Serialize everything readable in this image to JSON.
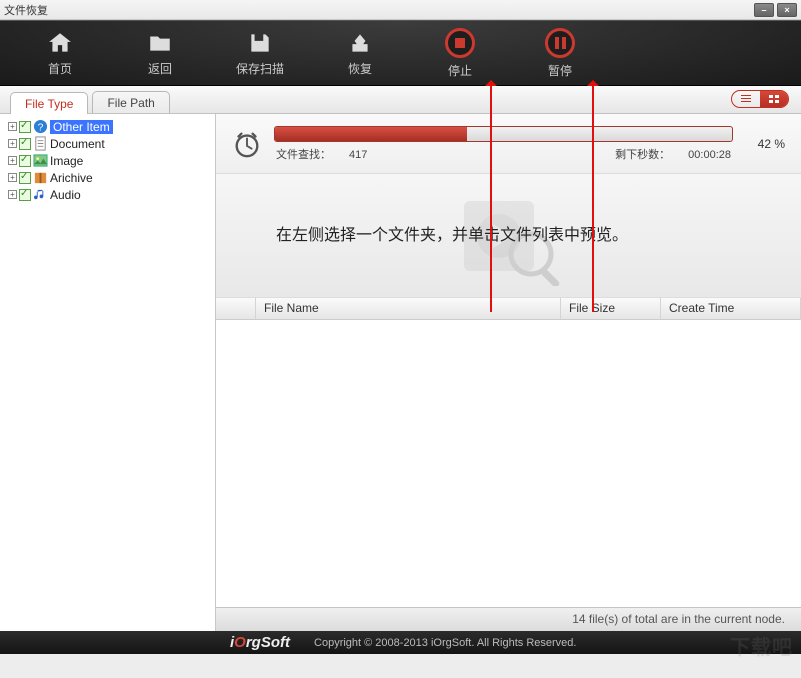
{
  "window": {
    "title": "文件恢复"
  },
  "toolbar": {
    "home": "首页",
    "back": "返回",
    "save_scan": "保存扫描",
    "recover": "恢复",
    "stop": "停止",
    "pause": "暂停"
  },
  "tabs": {
    "file_type": "File Type",
    "file_path": "File Path"
  },
  "tree": {
    "items": [
      {
        "label": "Other Item"
      },
      {
        "label": "Document"
      },
      {
        "label": "Image"
      },
      {
        "label": "Arichive"
      },
      {
        "label": "Audio"
      }
    ]
  },
  "progress": {
    "percent_label": "42 %",
    "percent_value": 42,
    "files_label": "文件查找：",
    "files_value": "417",
    "remain_label": "剩下秒数：",
    "remain_value": "00:00:28"
  },
  "preview": {
    "message": "在左侧选择一个文件夹，并单击文件列表中预览。"
  },
  "table": {
    "headers": {
      "name": "File Name",
      "size": "File Size",
      "ctime": "Create Time"
    }
  },
  "status": {
    "text": "14 file(s) of total are in the current node."
  },
  "footer": {
    "copyright": "Copyright © 2008-2013 iOrgSoft. All Rights Reserved."
  },
  "watermark": "下载吧"
}
